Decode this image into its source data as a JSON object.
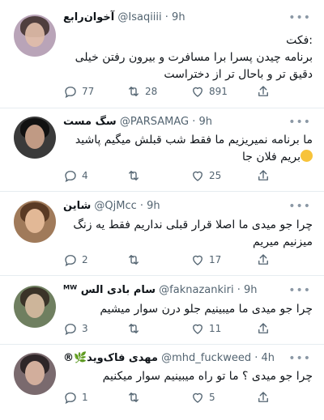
{
  "tweets": [
    {
      "name": "آخوان‌رابع",
      "handle": "@Isaqiiii · 9h",
      "lines": [
        ":فکت",
        "برنامه چیدن پسرا برا مسافرت و بیرون رفتن خیلی",
        "دقیق تر و باحال تر از دختراست"
      ],
      "reply": "77",
      "retweet": "28",
      "like": "891",
      "avatar_color": "#b9a4b8"
    },
    {
      "name": "سگ مست",
      "handle": "@PARSAMAG · 9h",
      "lines": [
        "ما برنامه نمیریزیم ما فقط شب قبلش میگیم پاشید",
        "بریم فلان جا"
      ],
      "reply": "4",
      "retweet": "",
      "like": "25",
      "avatar_color": "#3a3a3a"
    },
    {
      "name": "شاین",
      "handle": "@QjMcc · 9h",
      "lines": [
        "چرا جو میدی ما اصلا قرار قبلی نداریم فقط یه زنگ",
        "میزنیم میریم"
      ],
      "reply": "2",
      "retweet": "",
      "like": "17",
      "avatar_color": "#a07a5a"
    },
    {
      "name": "سام بادی الس ᴹᵂ",
      "handle": "@faknazankiri · 9h",
      "lines": [
        "چرا جو میدی ما میبینیم جلو درن سوار میشیم"
      ],
      "reply": "3",
      "retweet": "",
      "like": "11",
      "avatar_color": "#6f7f60"
    },
    {
      "name": "مهدی فاک‌وید🌿®",
      "handle": "@mhd_fuckweed · 4h",
      "lines": [
        "چرا جو میدی ؟ ما تو راه میبینیم سوار میکنیم"
      ],
      "reply": "1",
      "retweet": "",
      "like": "5",
      "avatar_color": "#7a6a6e"
    }
  ],
  "more_label": "•••",
  "colors": {
    "text": "#0f1419",
    "muted": "#536471",
    "border": "#e6ecf0"
  }
}
